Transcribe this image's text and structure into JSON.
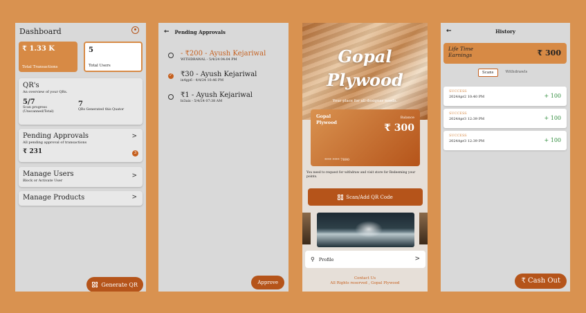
{
  "dashboard": {
    "title": "Dashboard",
    "transactions_value": "₹ 1.33 K",
    "transactions_label": "Total Transactions",
    "users_value": "5",
    "users_label": "Total Users",
    "qr_title": "QR's",
    "qr_subtitle": "An overview of your QRs.",
    "scan_progress_value": "5/7",
    "scan_progress_label": "Scan progress (Unscanned/Total)",
    "generated_value": "7",
    "generated_label": "QRs Generated this Quator",
    "pending_title": "Pending Approvals",
    "pending_subtitle": "All pending approval of transactions",
    "pending_amount": "₹  231",
    "pending_badge": "3",
    "manage_users_title": "Manage Users",
    "manage_users_subtitle": "Block or Activate User",
    "manage_products_title": "Manage Products",
    "generate_button": "Generate QR"
  },
  "pending": {
    "title": "Pending Approvals",
    "items": [
      {
        "main": "- ₹200 - Ayush Kejariwal",
        "sub": "WITHDRAWAL - 5/4/24 04:04 PM"
      },
      {
        "main": "₹30 - Ayush Kejariwal",
        "sub": "in4gp6 - 4/4/24 10:46 PM"
      },
      {
        "main": "₹1 - Ayush Kejariwal",
        "sub": "bi3aix - 5/4/24 07:38 AM"
      }
    ],
    "approve_button": "Approve"
  },
  "home": {
    "brand_line1": "Gopal",
    "brand_line2": "Plywood",
    "tagline": "Your place for all designer needs.",
    "card_name_line1": "Gopal",
    "card_name_line2": "Plywood",
    "balance_label": "Balance",
    "balance_amount": "₹ 300",
    "card_number": "**** **** 7890",
    "note": "You need to request for withdraw and visit store for Redeeming your points.",
    "scan_button": "Scan/Add QR Code",
    "profile_label": "Profile",
    "footer_contact": "Contact Us",
    "footer_rights": "All Rights reserved , Gopal Plywood"
  },
  "history": {
    "title": "History",
    "earnings_label_line1": "Life Time",
    "earnings_label_line2": "Earnings",
    "earnings_amount": "₹ 300",
    "tab_scans": "Scans",
    "tab_withdrawls": "Withdrawls",
    "entries": [
      {
        "status": "SUCCESS",
        "date": "2024Apr2 10:40 PM",
        "amount": "+ 100"
      },
      {
        "status": "SUCCESS",
        "date": "2024Apr3 12:39 PM",
        "amount": "+ 100"
      },
      {
        "status": "SUCCESS",
        "date": "2024Apr3 12:39 PM",
        "amount": "+ 100"
      }
    ],
    "cash_out_button": "₹ Cash Out"
  },
  "colors": {
    "background": "#D99250",
    "accent": "#B5541A",
    "card_accent": "#D78A45",
    "success_green": "#2e8b3a"
  }
}
